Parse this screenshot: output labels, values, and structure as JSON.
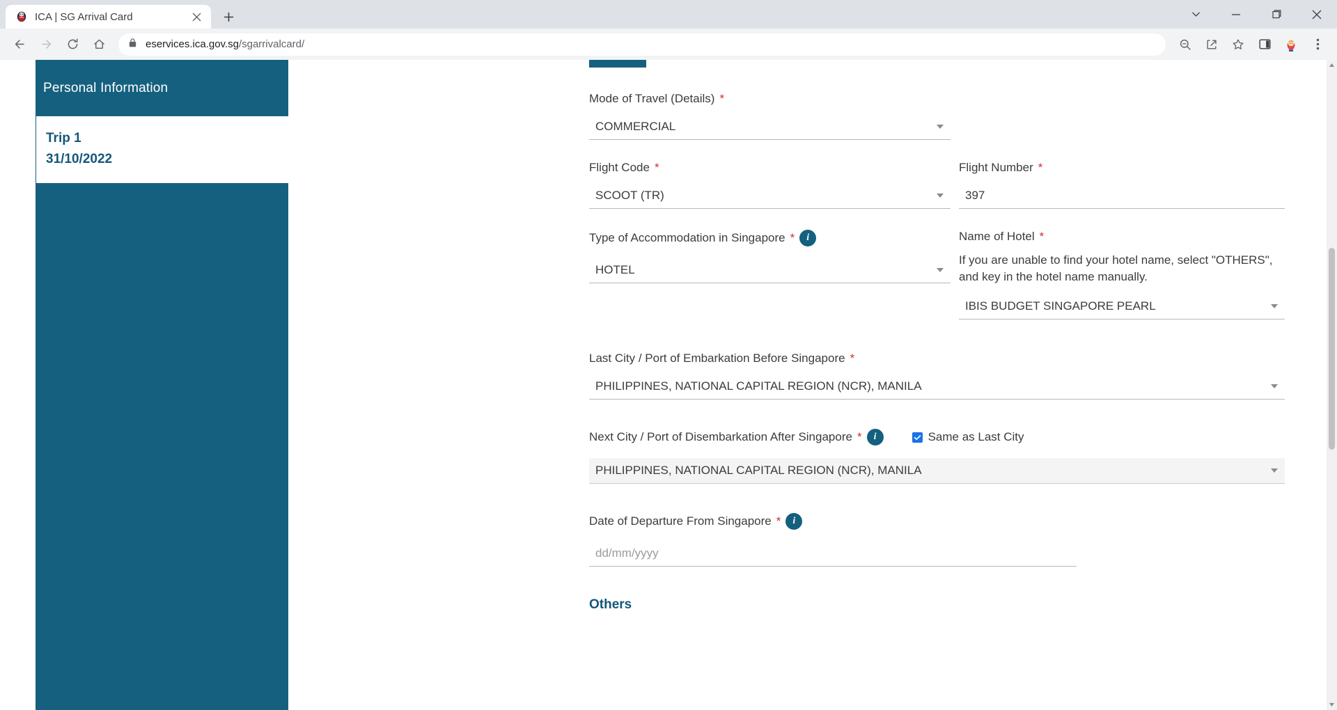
{
  "browser": {
    "tab": {
      "title": "ICA | SG Arrival Card",
      "favicon_icon": "ica-lion-favicon",
      "close_icon": "close-icon"
    },
    "new_tab_icon": "plus-icon",
    "window_controls": {
      "expand_icon": "chevron-down-icon",
      "minimize_icon": "minimize-icon",
      "maximize_icon": "restore-icon",
      "close_icon": "close-icon"
    },
    "nav": {
      "back_icon": "back-arrow-icon",
      "forward_icon": "forward-arrow-icon",
      "reload_icon": "reload-icon",
      "home_icon": "home-icon"
    },
    "omnibox": {
      "lock_icon": "lock-icon",
      "url_host": "eservices.ica.gov.sg",
      "url_path": "/sgarrivalcard/"
    },
    "actions": {
      "zoom_out_icon": "zoom-out-icon",
      "share_icon": "share-icon",
      "bookmark_icon": "star-icon",
      "side_panel_icon": "side-panel-icon",
      "profile_icon": "profile-avatar-icon",
      "menu_icon": "three-dot-menu-icon"
    }
  },
  "sidebar": {
    "heading": "Personal Information",
    "trip": {
      "title": "Trip 1",
      "date": "31/10/2022"
    }
  },
  "form": {
    "mode_of_travel": {
      "label": "Mode of Travel (Details)",
      "required": "*",
      "value": "COMMERCIAL",
      "caret_icon": "chevron-down-icon"
    },
    "flight_code": {
      "label": "Flight Code",
      "required": "*",
      "value": "SCOOT (TR)",
      "caret_icon": "chevron-down-icon"
    },
    "flight_number": {
      "label": "Flight Number",
      "required": "*",
      "value": "397"
    },
    "accommodation_type": {
      "label": "Type of Accommodation in Singapore",
      "required": "*",
      "info_icon": "info-icon",
      "value": "HOTEL",
      "caret_icon": "chevron-down-icon"
    },
    "hotel_name": {
      "label": "Name of Hotel",
      "required": "*",
      "help_text": "If you are unable to find your hotel name, select \"OTHERS\", and key in the hotel name manually.",
      "value": "IBIS BUDGET SINGAPORE PEARL",
      "caret_icon": "chevron-down-icon"
    },
    "last_city": {
      "label": "Last City / Port of Embarkation Before Singapore",
      "required": "*",
      "value": "PHILIPPINES, NATIONAL CAPITAL REGION (NCR), MANILA",
      "caret_icon": "chevron-down-icon"
    },
    "next_city": {
      "label": "Next City / Port of Disembarkation After Singapore",
      "required": "*",
      "info_icon": "info-icon",
      "checkbox_label": "Same as Last City",
      "checkbox_checked": true,
      "value": "PHILIPPINES, NATIONAL CAPITAL REGION (NCR), MANILA",
      "caret_icon": "chevron-down-icon"
    },
    "departure_date": {
      "label": "Date of Departure From Singapore",
      "required": "*",
      "info_icon": "info-icon",
      "placeholder": "dd/mm/yyyy",
      "value": ""
    },
    "others_heading": "Others"
  },
  "colors": {
    "brand_teal": "#16607f",
    "heading_blue": "#14577a",
    "required_red": "#d32f2f",
    "checkbox_blue": "#1a73e8"
  }
}
